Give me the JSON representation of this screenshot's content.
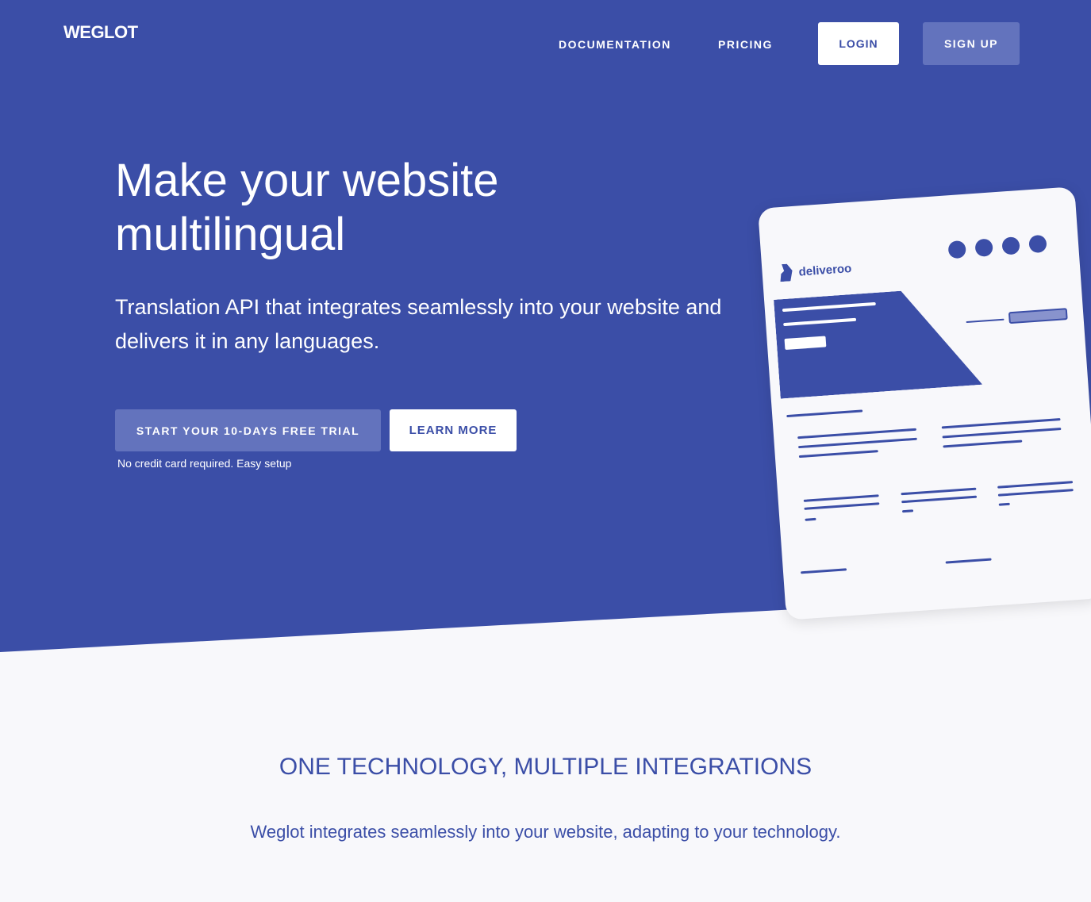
{
  "header": {
    "logo": "WEGLOT",
    "nav": {
      "documentation": "DOCUMENTATION",
      "pricing": "PRICING"
    },
    "login": "LOGIN",
    "signup": "SIGN UP"
  },
  "hero": {
    "title": "Make your website multilingual",
    "subtitle": "Translation API that integrates seamlessly into your website and delivers it in any languages.",
    "cta_primary": "START YOUR 10-DAYS FREE TRIAL",
    "cta_secondary": "LEARN MORE",
    "note": "No credit card required. Easy setup"
  },
  "mockup": {
    "brand": "deliveroo",
    "flags": [
      "uk-flag-icon",
      "language-flag-icon",
      "language-flag-icon",
      "france-flag-icon"
    ]
  },
  "integrations": {
    "title": "ONE TECHNOLOGY, MULTIPLE INTEGRATIONS",
    "subtitle": "Weglot integrates seamlessly into your website, adapting to your technology."
  },
  "colors": {
    "brand_blue": "#3b4ea7",
    "button_light_blue": "#6373bd",
    "background": "#f8f8fb"
  }
}
